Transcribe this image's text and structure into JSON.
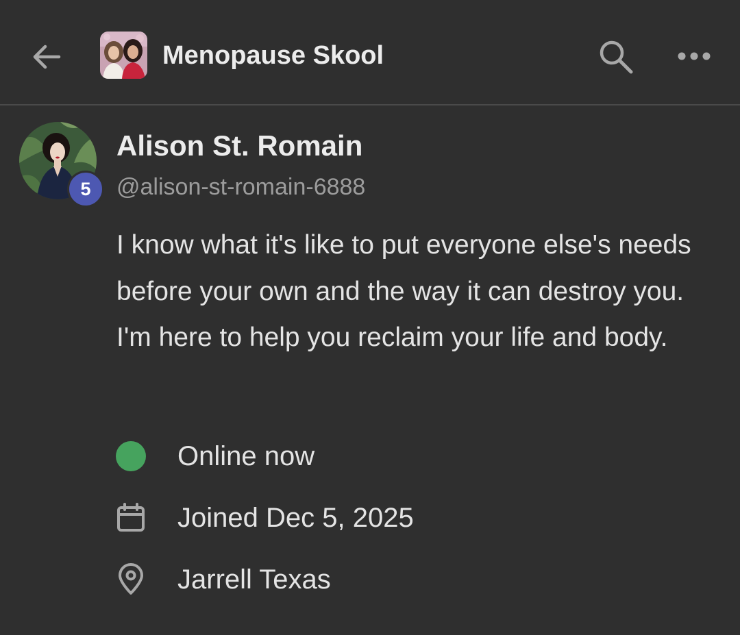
{
  "header": {
    "group_name": "Menopause Skool",
    "icons": {
      "back": "arrow-left-icon",
      "search": "search-icon",
      "more": "more-horizontal-icon"
    }
  },
  "profile": {
    "name": "Alison St. Romain",
    "handle": "@alison-st-romain-6888",
    "level": "5",
    "bio": "I know what it's like to put everyone else's needs before your own and the way it can destroy you. I'm here to help you reclaim your life and body."
  },
  "info": {
    "status": "Online now",
    "joined": "Joined Dec 5, 2025",
    "location": "Jarrell Texas"
  },
  "colors": {
    "background": "#2f2f2f",
    "divider": "#4a4a4a",
    "online": "#46a35e",
    "level_badge": "#4d58b2",
    "icon_gray": "#a8a8a8",
    "secondary_text": "#9c9c9c"
  }
}
